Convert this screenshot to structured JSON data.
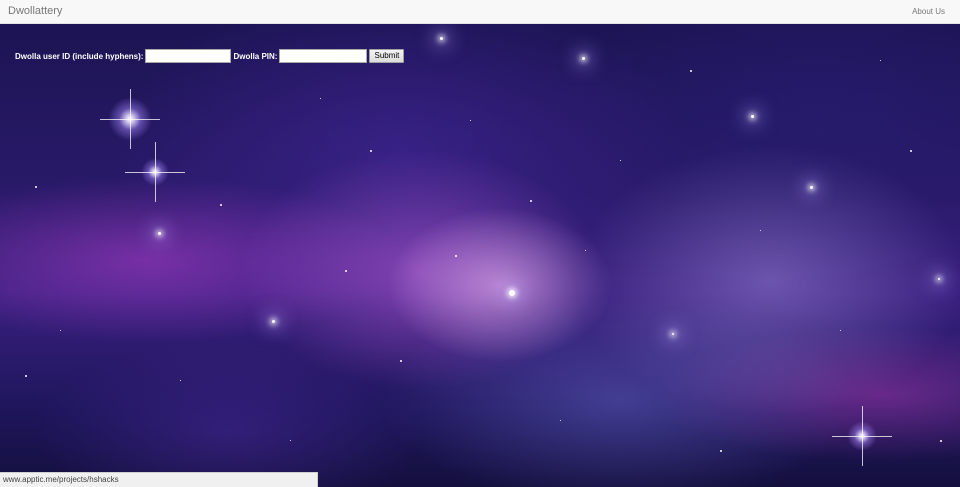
{
  "navbar": {
    "brand": "Dwollattery",
    "links": [
      "About Us"
    ]
  },
  "form": {
    "userid_label": "Dwolla user ID (include hyphens):",
    "userid_value": "",
    "pin_label": "Dwolla PIN:",
    "pin_value": "",
    "submit_label": "Submit"
  },
  "status_bar": {
    "url": "www.apptic.me/projects/hshacks"
  },
  "colors": {
    "navbar_bg": "#f8f8f8",
    "nav_text": "#777777",
    "label_text": "#ffffff"
  }
}
